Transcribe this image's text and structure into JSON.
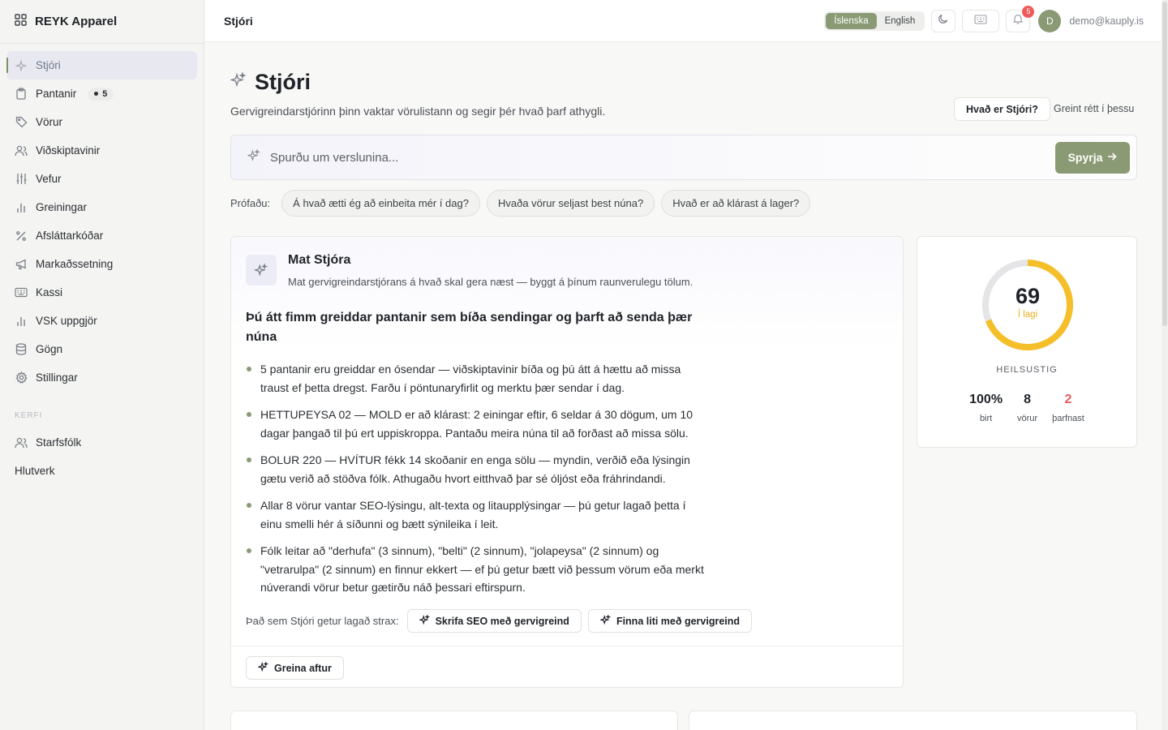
{
  "app": {
    "brand": "REYK Apparel"
  },
  "sidebar": {
    "items": [
      {
        "label": "Stjóri",
        "icon": "sparkle-icon",
        "active": true
      },
      {
        "label": "Pantanir",
        "icon": "clipboard-icon",
        "badge": "5"
      },
      {
        "label": "Vörur",
        "icon": "tag-icon"
      },
      {
        "label": "Viðskiptavinir",
        "icon": "users-icon"
      },
      {
        "label": "Vefur",
        "icon": "sliders-icon"
      },
      {
        "label": "Greiningar",
        "icon": "bar-chart-icon"
      },
      {
        "label": "Afsláttarkóðar",
        "icon": "percent-icon"
      },
      {
        "label": "Markaðssetning",
        "icon": "megaphone-icon"
      },
      {
        "label": "Kassi",
        "icon": "keyboard-icon"
      },
      {
        "label": "VSK uppgjör",
        "icon": "bar-chart-icon"
      },
      {
        "label": "Gögn",
        "icon": "database-icon"
      },
      {
        "label": "Stillingar",
        "icon": "gear-icon"
      }
    ],
    "system_label": "KERFI",
    "system_items": [
      {
        "label": "Starfsfólk",
        "icon": "users-icon"
      },
      {
        "label": "Hlutverk"
      }
    ]
  },
  "topbar": {
    "title": "Stjóri",
    "lang_is": "Íslenska",
    "lang_en": "English",
    "notifications": "5",
    "avatar_initial": "D",
    "user_email": "demo@kauply.is"
  },
  "page": {
    "title": "Stjóri",
    "subtitle": "Gervigreindarstjórinn þinn vaktar vörulistann og segir þér hvað þarf athygli.",
    "what_button": "Hvað er Stjóri?",
    "analyzed_text": "Greint rétt í þessu",
    "ask_placeholder": "Spurðu um verslunina...",
    "ask_button": "Spyrja",
    "try_label": "Prófaðu:",
    "suggestions": [
      "Á hvað ætti ég að einbeita mér í dag?",
      "Hvaða vörur seljast best núna?",
      "Hvað er að klárast á lager?"
    ]
  },
  "assessment": {
    "title": "Mat Stjóra",
    "description": "Mat gervigreindarstjórans á hvað skal gera næst — byggt á þínum raunverulegu tölum.",
    "headline": "Þú átt fimm greiddar pantanir sem bíða sendingar og þarft að senda þær núna",
    "bullets": [
      "5 pantanir eru greiddar en ósendar — viðskiptavinir bíða og þú átt á hættu að missa traust ef þetta dregst. Farðu í pöntunaryfirlit og merktu þær sendar í dag.",
      "HETTUPEYSA 02 — MOLD er að klárast: 2 einingar eftir, 6 seldar á 30 dögum, um 10 dagar þangað til þú ert uppiskroppa. Pantaðu meira núna til að forðast að missa sölu.",
      "BOLUR 220 — HVÍTUR fékk 14 skoðanir en enga sölu — myndin, verðið eða lýsingin gætu verið að stöðva fólk. Athugaðu hvort eitthvað þar sé óljóst eða fráhrindandi.",
      "Allar 8 vörur vantar SEO-lýsingu, alt-texta og litaupplýsingar — þú getur lagað þetta í einu smelli hér á síðunni og bætt sýnileika í leit.",
      "Fólk leitar að \"derhufa\" (3 sinnum), \"belti\" (2 sinnum), \"jolapeysa\" (2 sinnum) og \"vetrarulpa\" (2 sinnum) en finnur ekkert — ef þú getur bætt við þessum vörum eða merkt núverandi vörur betur gætirðu náð þessari eftirspurn."
    ],
    "fix_label": "Það sem Stjóri getur lagað strax:",
    "fix_seo": "Skrifa SEO með gervigreind",
    "fix_colors": "Finna liti með gervigreind",
    "reanalyze": "Greina aftur"
  },
  "health": {
    "score": "69",
    "score_value": 69,
    "status": "Í lagi",
    "label": "HEILSUSTIG",
    "stats": [
      {
        "value": "100%",
        "label": "birt"
      },
      {
        "value": "8",
        "label": "vörur"
      },
      {
        "value": "2",
        "label": "þarfnast"
      }
    ],
    "colors": {
      "gauge": "#f5bf2a",
      "track": "#e5e5e8",
      "warn": "#ea5b5b"
    }
  },
  "colors": {
    "accent": "#8a9a74"
  }
}
